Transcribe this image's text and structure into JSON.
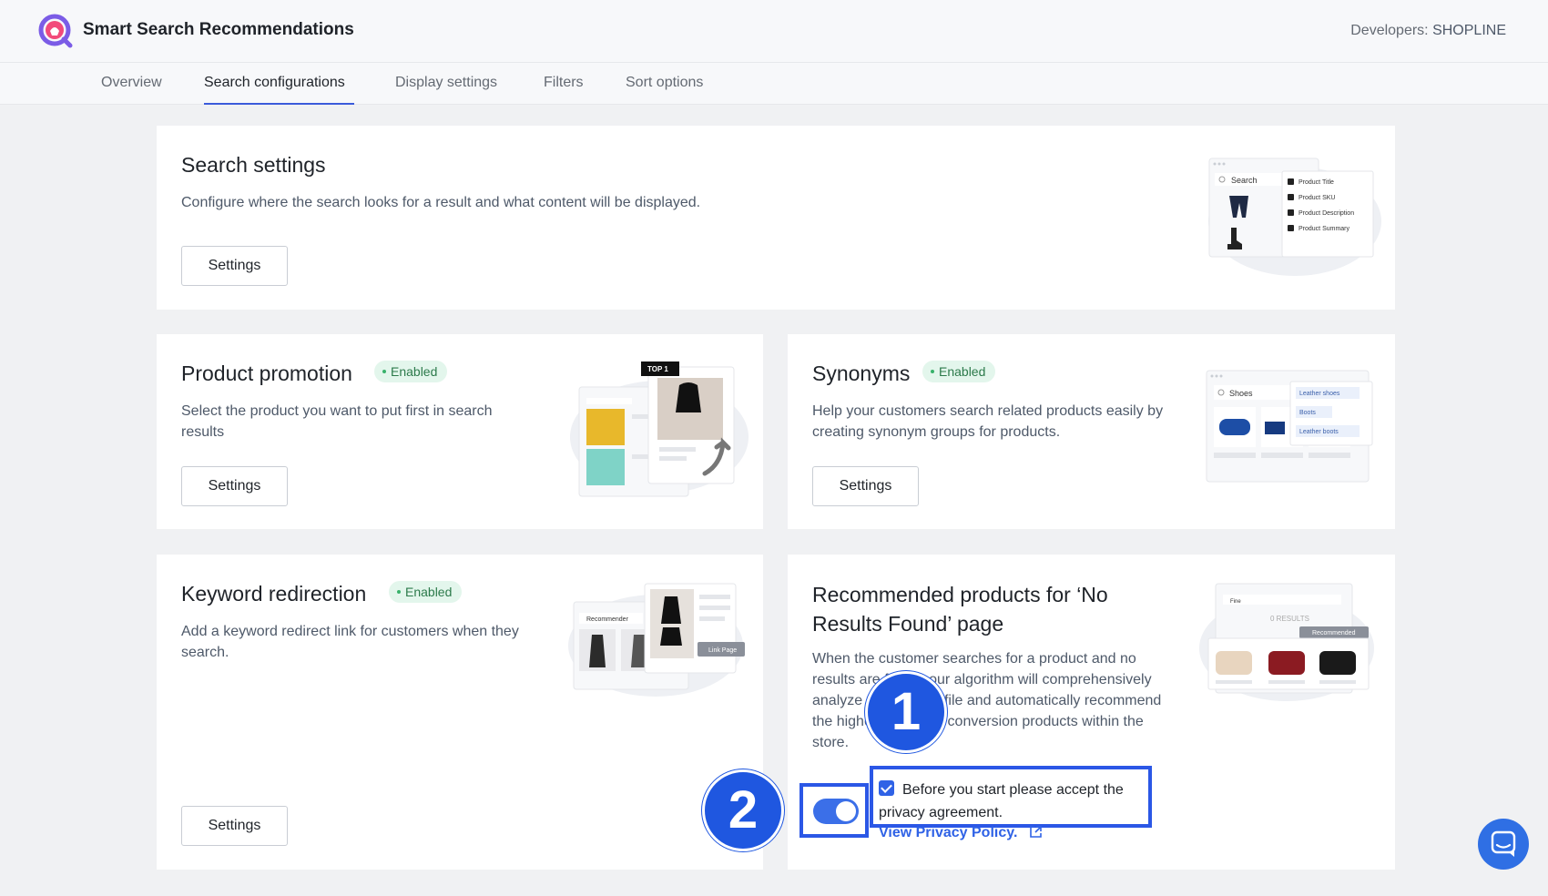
{
  "header": {
    "app_title": "Smart Search Recommendations",
    "developer_label": "Developers:",
    "developer_name": "SHOPLINE"
  },
  "tabs": [
    {
      "label": "Overview",
      "active": false
    },
    {
      "label": "Search configurations",
      "active": true
    },
    {
      "label": "Display settings",
      "active": false
    },
    {
      "label": "Filters",
      "active": false
    },
    {
      "label": "Sort options",
      "active": false
    }
  ],
  "cards": {
    "search_settings": {
      "title": "Search settings",
      "description": "Configure where the search looks for a result and what content will be displayed.",
      "button": "Settings",
      "illus": {
        "search": "Search",
        "options": [
          "Product Title",
          "Product SKU",
          "Product Description",
          "Product Summary"
        ]
      }
    },
    "product_promotion": {
      "title": "Product promotion",
      "badge": "Enabled",
      "description": "Select the product you want to put first in search results",
      "button": "Settings",
      "illus": {
        "tag": "TOP 1"
      }
    },
    "synonyms": {
      "title": "Synonyms",
      "badge": "Enabled",
      "description": "Help your customers search related products easily by creating synonym groups for products.",
      "button": "Settings",
      "illus": {
        "search": "Shoes",
        "tags": [
          "Leather shoes",
          "Boots",
          "Leather boots"
        ]
      }
    },
    "keyword_redirection": {
      "title": "Keyword redirection",
      "badge": "Enabled",
      "description": "Add a keyword redirect link for customers when they search.",
      "button": "Settings",
      "illus": {
        "search": "Recommender",
        "link": "Link Page"
      }
    },
    "recommended": {
      "title_line1": "Recommended products for ‘No",
      "title_line2": "Results Found’ page",
      "description": "When the customer searches for a product and no results are found, our algorithm will comprehensively analyze the user profile and automatically recommend the highest-potential conversion products within the store.",
      "agreement": "Before you start please accept the privacy agreement.",
      "policy_link": "View Privacy Policy.",
      "toggle_on": true,
      "checkbox_checked": true,
      "illus": {
        "search": "Fine",
        "results": "0 RESULTS",
        "recommended": "Recommended"
      }
    }
  },
  "annotations": {
    "step1": "1",
    "step2": "2"
  },
  "colors": {
    "accent": "#2f62e6",
    "badge_bg": "#e3f6ec",
    "badge_text": "#2c7a4b",
    "highlight": "#2b57e6"
  }
}
